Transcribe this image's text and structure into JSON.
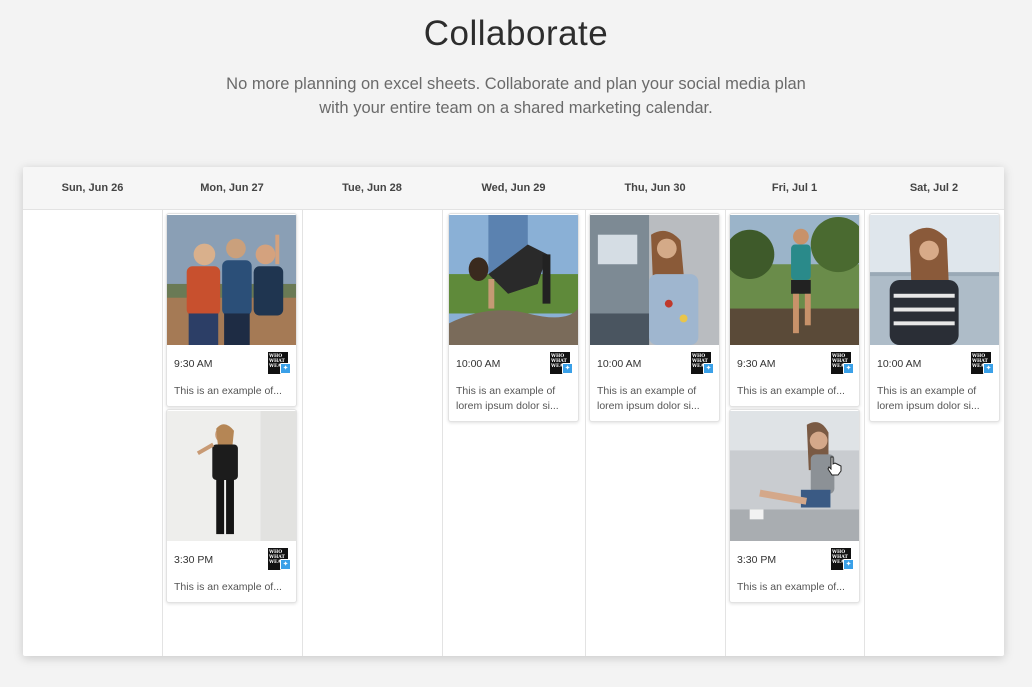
{
  "header": {
    "title": "Collaborate",
    "subtitle_line1": "No more planning on excel sheets. Collaborate and plan your social media plan",
    "subtitle_line2": "with your entire team on a shared marketing calendar."
  },
  "calendar": {
    "days": [
      {
        "label": "Sun, Jun 26"
      },
      {
        "label": "Mon, Jun 27"
      },
      {
        "label": "Tue, Jun 28"
      },
      {
        "label": "Wed, Jun 29"
      },
      {
        "label": "Thu, Jun 30"
      },
      {
        "label": "Fri, Jul 1"
      },
      {
        "label": "Sat, Jul 2"
      }
    ],
    "posts": {
      "mon_1": {
        "time": "9:30 AM",
        "text1": "This is an example of...",
        "text2": ""
      },
      "mon_2": {
        "time": "3:30 PM",
        "text1": "This is an example of...",
        "text2": ""
      },
      "wed_1": {
        "time": "10:00 AM",
        "text1": "This is an example of",
        "text2": "lorem ipsum dolor si..."
      },
      "thu_1": {
        "time": "10:00 AM",
        "text1": "This is an example of",
        "text2": "lorem ipsum dolor si..."
      },
      "fri_1": {
        "time": "9:30 AM",
        "text1": "This is an example of...",
        "text2": ""
      },
      "fri_2": {
        "time": "3:30 PM",
        "text1": "This is an example of...",
        "text2": ""
      },
      "sat_1": {
        "time": "10:00 AM",
        "text1": "This is an example of",
        "text2": "lorem ipsum dolor si..."
      }
    },
    "account_logo_text": "WHO WHAT WEAR",
    "network_icon": "twitter-icon"
  },
  "colors": {
    "page_bg": "#f3f3f3",
    "header_bg": "#f6f6f6",
    "twitter": "#3aa0e8"
  }
}
